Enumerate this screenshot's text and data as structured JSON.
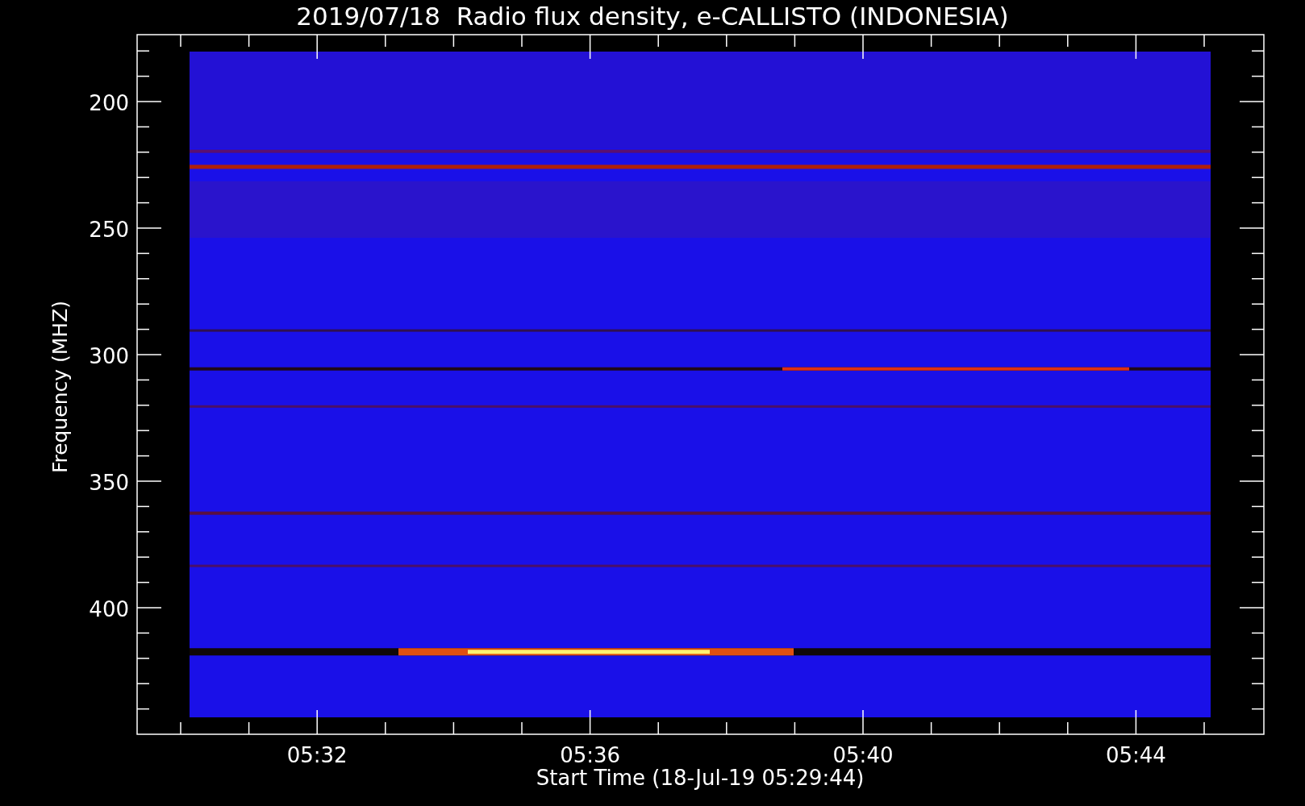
{
  "title": "2019/07/18  Radio flux density, e-CALLISTO (INDONESIA)",
  "y_axis": {
    "label": "Frequency (MHZ)",
    "ticks": [
      "200",
      "250",
      "300",
      "350",
      "400"
    ]
  },
  "x_axis": {
    "label": "Start Time (18-Jul-19 05:29:44)",
    "ticks": [
      "05:32",
      "05:36",
      "05:40",
      "05:44"
    ]
  }
}
